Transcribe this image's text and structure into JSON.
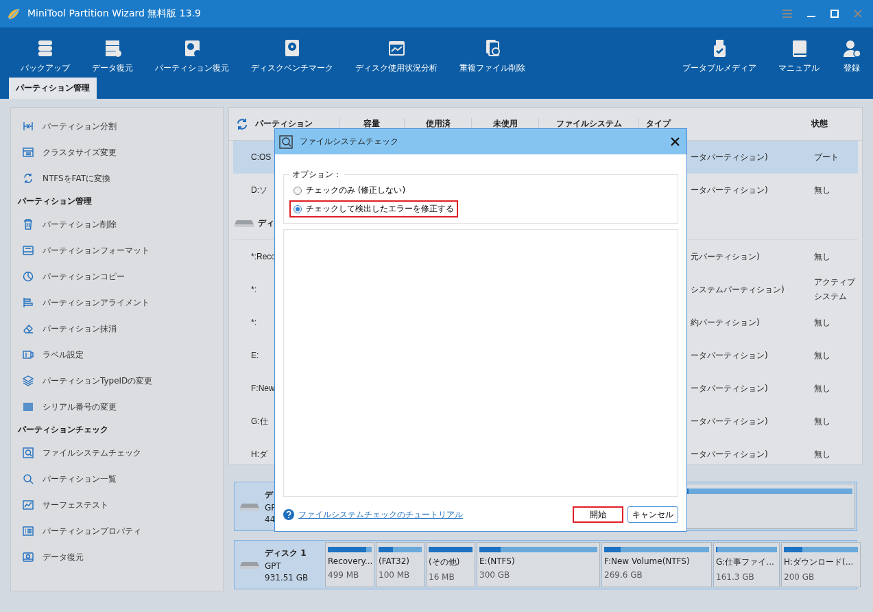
{
  "window": {
    "title": "MiniTool Partition Wizard 無料版 13.9"
  },
  "toolbar": {
    "left": [
      {
        "label": "バックアップ"
      },
      {
        "label": "データ復元"
      },
      {
        "label": "パーティション復元"
      },
      {
        "label": "ディスクベンチマーク"
      },
      {
        "label": "ディスク使用状況分析"
      },
      {
        "label": "重複ファイル削除"
      }
    ],
    "right": [
      {
        "label": "ブータブルメディア"
      },
      {
        "label": "マニュアル"
      },
      {
        "label": "登録"
      }
    ]
  },
  "tabs": [
    {
      "label": "パーティション管理",
      "selected": true
    }
  ],
  "sidebar": {
    "sections": [
      {
        "items": [
          "パーティション分割",
          "クラスタサイズ変更",
          "NTFSをFATに変換"
        ]
      },
      {
        "title": "パーティション管理",
        "items": [
          "パーティション削除",
          "パーティションフォーマット",
          "パーティションコピー",
          "パーティションアライメント",
          "パーティション抹消",
          "ラベル設定",
          "パーティションTypeIDの変更",
          "シリアル番号の変更"
        ]
      },
      {
        "title": "パーティションチェック",
        "items": [
          "ファイルシステムチェック",
          "パーティション一覧",
          "サーフェステスト",
          "パーティションプロパティ",
          "データ復元"
        ]
      }
    ]
  },
  "table": {
    "columns": [
      "パーティション",
      "容量",
      "使用済",
      "未使用",
      "ファイルシステム",
      "タイプ",
      "状態"
    ],
    "rows": [
      {
        "kind": "partition",
        "name": "C:OS",
        "type": "ータパーティション)",
        "status": [
          "ブート"
        ],
        "selected": true
      },
      {
        "kind": "partition",
        "name": "D:ソ",
        "type": "ータパーティション)",
        "status": [
          "無し"
        ],
        "selected": false
      },
      {
        "kind": "disk",
        "name": "ディ"
      },
      {
        "kind": "partition",
        "name": "*:Reco",
        "type": "元パーティション)",
        "status": [
          "無し"
        ],
        "selected": false
      },
      {
        "kind": "partition",
        "name": "*:",
        "type": "システムパーティション)",
        "status": [
          "アクティブ",
          "システム"
        ],
        "selected": false
      },
      {
        "kind": "partition",
        "name": "*:",
        "type": "約パーティション)",
        "status": [
          "無し"
        ],
        "selected": false
      },
      {
        "kind": "partition",
        "name": "E:",
        "type": "ータパーティション)",
        "status": [
          "無し"
        ],
        "selected": false
      },
      {
        "kind": "partition",
        "name": "F:New",
        "type": "ータパーティション)",
        "status": [
          "無し"
        ],
        "selected": false
      },
      {
        "kind": "partition",
        "name": "G:仕",
        "type": "ータパーティション)",
        "status": [
          "無し"
        ],
        "selected": false
      },
      {
        "kind": "partition",
        "name": "H:ダ",
        "type": "ータパーティション)",
        "status": [
          "無し"
        ],
        "selected": false
      }
    ]
  },
  "disk_map": {
    "disks": [
      {
        "name": "デ",
        "type": "GP",
        "size": "44",
        "partitions": [
          {
            "level": 0.03
          }
        ]
      },
      {
        "name": "ディスク 1",
        "type": "GPT",
        "size": "931.51 GB",
        "partitions": [
          {
            "label": "Recovery...",
            "size": "499 MB",
            "level": 0.88
          },
          {
            "label": "(FAT32)",
            "size": "100 MB",
            "level": 0.33
          },
          {
            "label": "(その他)",
            "size": "16 MB",
            "level": 1.0
          },
          {
            "label": "E:(NTFS)",
            "size": "300 GB",
            "level": 0.18
          },
          {
            "label": "F:New Volume(NTFS)",
            "size": "269.6 GB",
            "level": 0.16
          },
          {
            "label": "G:仕事ファイ...",
            "size": "161.3 GB",
            "level": 0.02
          },
          {
            "label": "H:ダウンロード(...",
            "size": "200 GB",
            "level": 0.25
          }
        ]
      }
    ]
  },
  "dialog": {
    "title": "ファイルシステムチェック",
    "options_label": "オプション：",
    "options": [
      {
        "label": "チェックのみ (修正しない)",
        "selected": false,
        "highlighted": false
      },
      {
        "label": "チェックして検出したエラーを修正する",
        "selected": true,
        "highlighted": true
      }
    ],
    "help_link": "ファイルシステムチェックのチュートリアル",
    "buttons": [
      {
        "label": "開始",
        "highlighted": true
      },
      {
        "label": "キャンセル",
        "highlighted": false
      }
    ]
  }
}
